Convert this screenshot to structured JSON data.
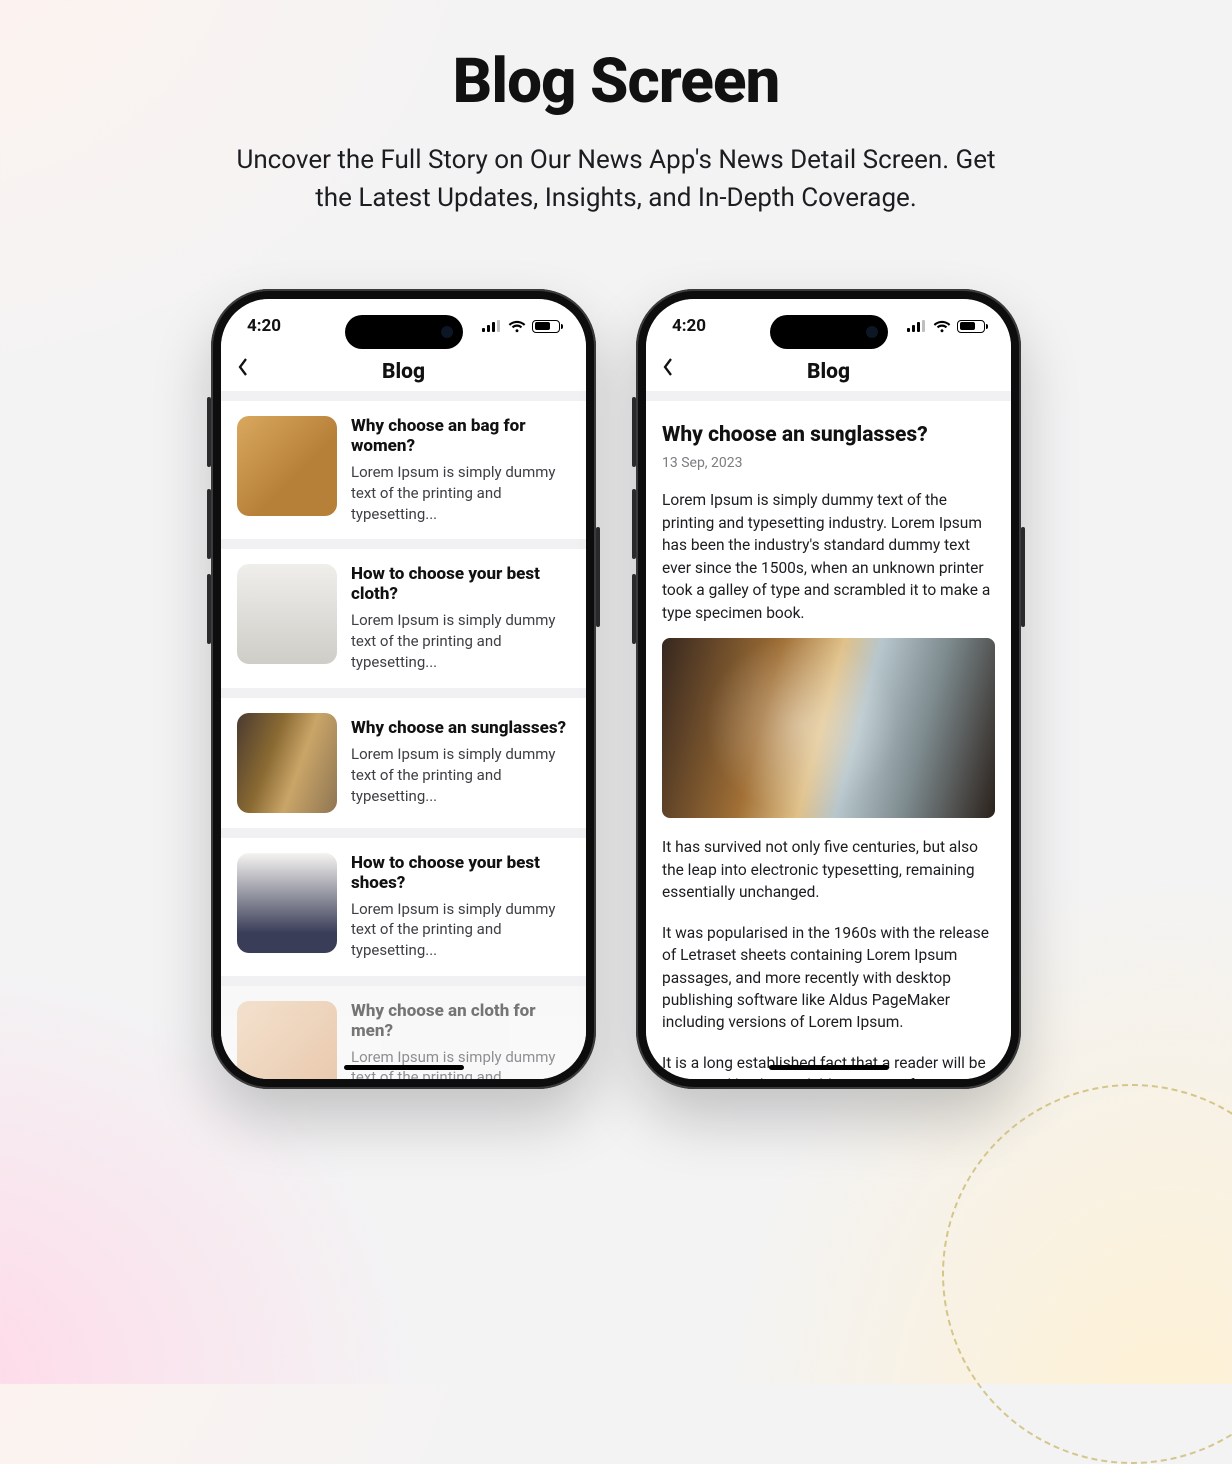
{
  "heading": {
    "title": "Blog Screen",
    "subtitle_line1": "Uncover the Full Story on Our News App's News Detail Screen. Get",
    "subtitle_line2": "the Latest Updates, Insights, and In-Depth Coverage."
  },
  "status": {
    "time": "4:20"
  },
  "nav": {
    "title": "Blog"
  },
  "list": {
    "excerpt": "Lorem Ipsum is simply dummy text of the printing and typesetting...",
    "items": [
      {
        "title": "Why choose an bag for women?"
      },
      {
        "title": "How to choose your best cloth?"
      },
      {
        "title": "Why choose an sunglasses?"
      },
      {
        "title": "How to choose your best shoes?"
      },
      {
        "title": "Why choose an cloth for men?"
      }
    ]
  },
  "detail": {
    "title": "Why choose an sunglasses?",
    "date": "13 Sep, 2023",
    "p1": "Lorem Ipsum is simply dummy text of the printing and typesetting industry. Lorem Ipsum has been the industry's standard dummy text ever since the 1500s, when an unknown printer took a galley of type and scrambled it to make a type specimen book.",
    "p2": "It has survived not only five centuries, but also the leap into electronic typesetting, remaining essentially unchanged.",
    "p3": "It was popularised in the 1960s with the release of Letraset sheets containing Lorem Ipsum passages, and more recently with desktop publishing software like Aldus PageMaker including versions of Lorem Ipsum.",
    "p4": "It is a long established fact that a reader will be distracted by the readable content of a page when looking at its layout."
  }
}
